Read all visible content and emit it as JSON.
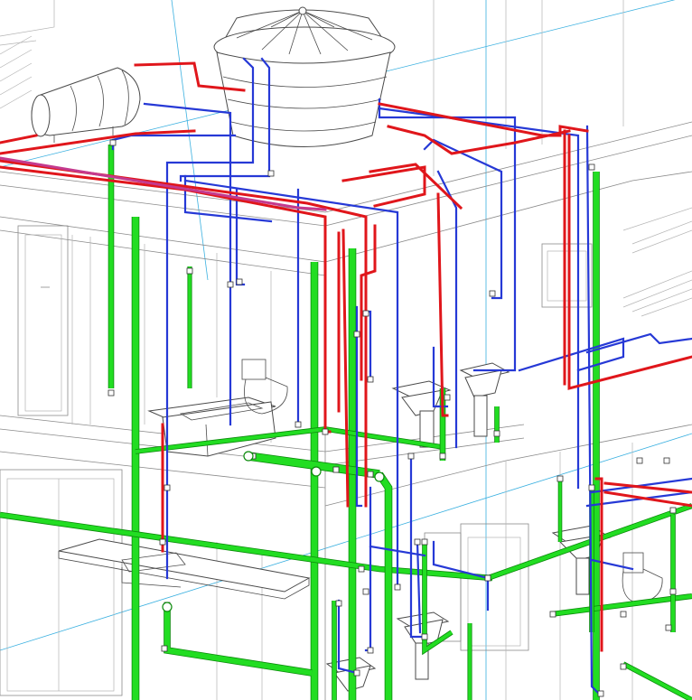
{
  "colors": {
    "hot_water": "#e0161b",
    "cold_water": "#2639d6",
    "drainage": "#22dd22",
    "drainage_outline": "#0b8a0b",
    "guide_line": "#3ab0e0",
    "gas_magenta": "#c43a8e"
  },
  "systems": [
    {
      "key": "hot",
      "color_name": "red"
    },
    {
      "key": "cold",
      "color_name": "blue"
    },
    {
      "key": "drain",
      "color_name": "green"
    }
  ],
  "fixtures": [
    "water-tank",
    "solar-boiler",
    "laundry-sink",
    "washbasin",
    "toilet",
    "kitchen-counter"
  ]
}
